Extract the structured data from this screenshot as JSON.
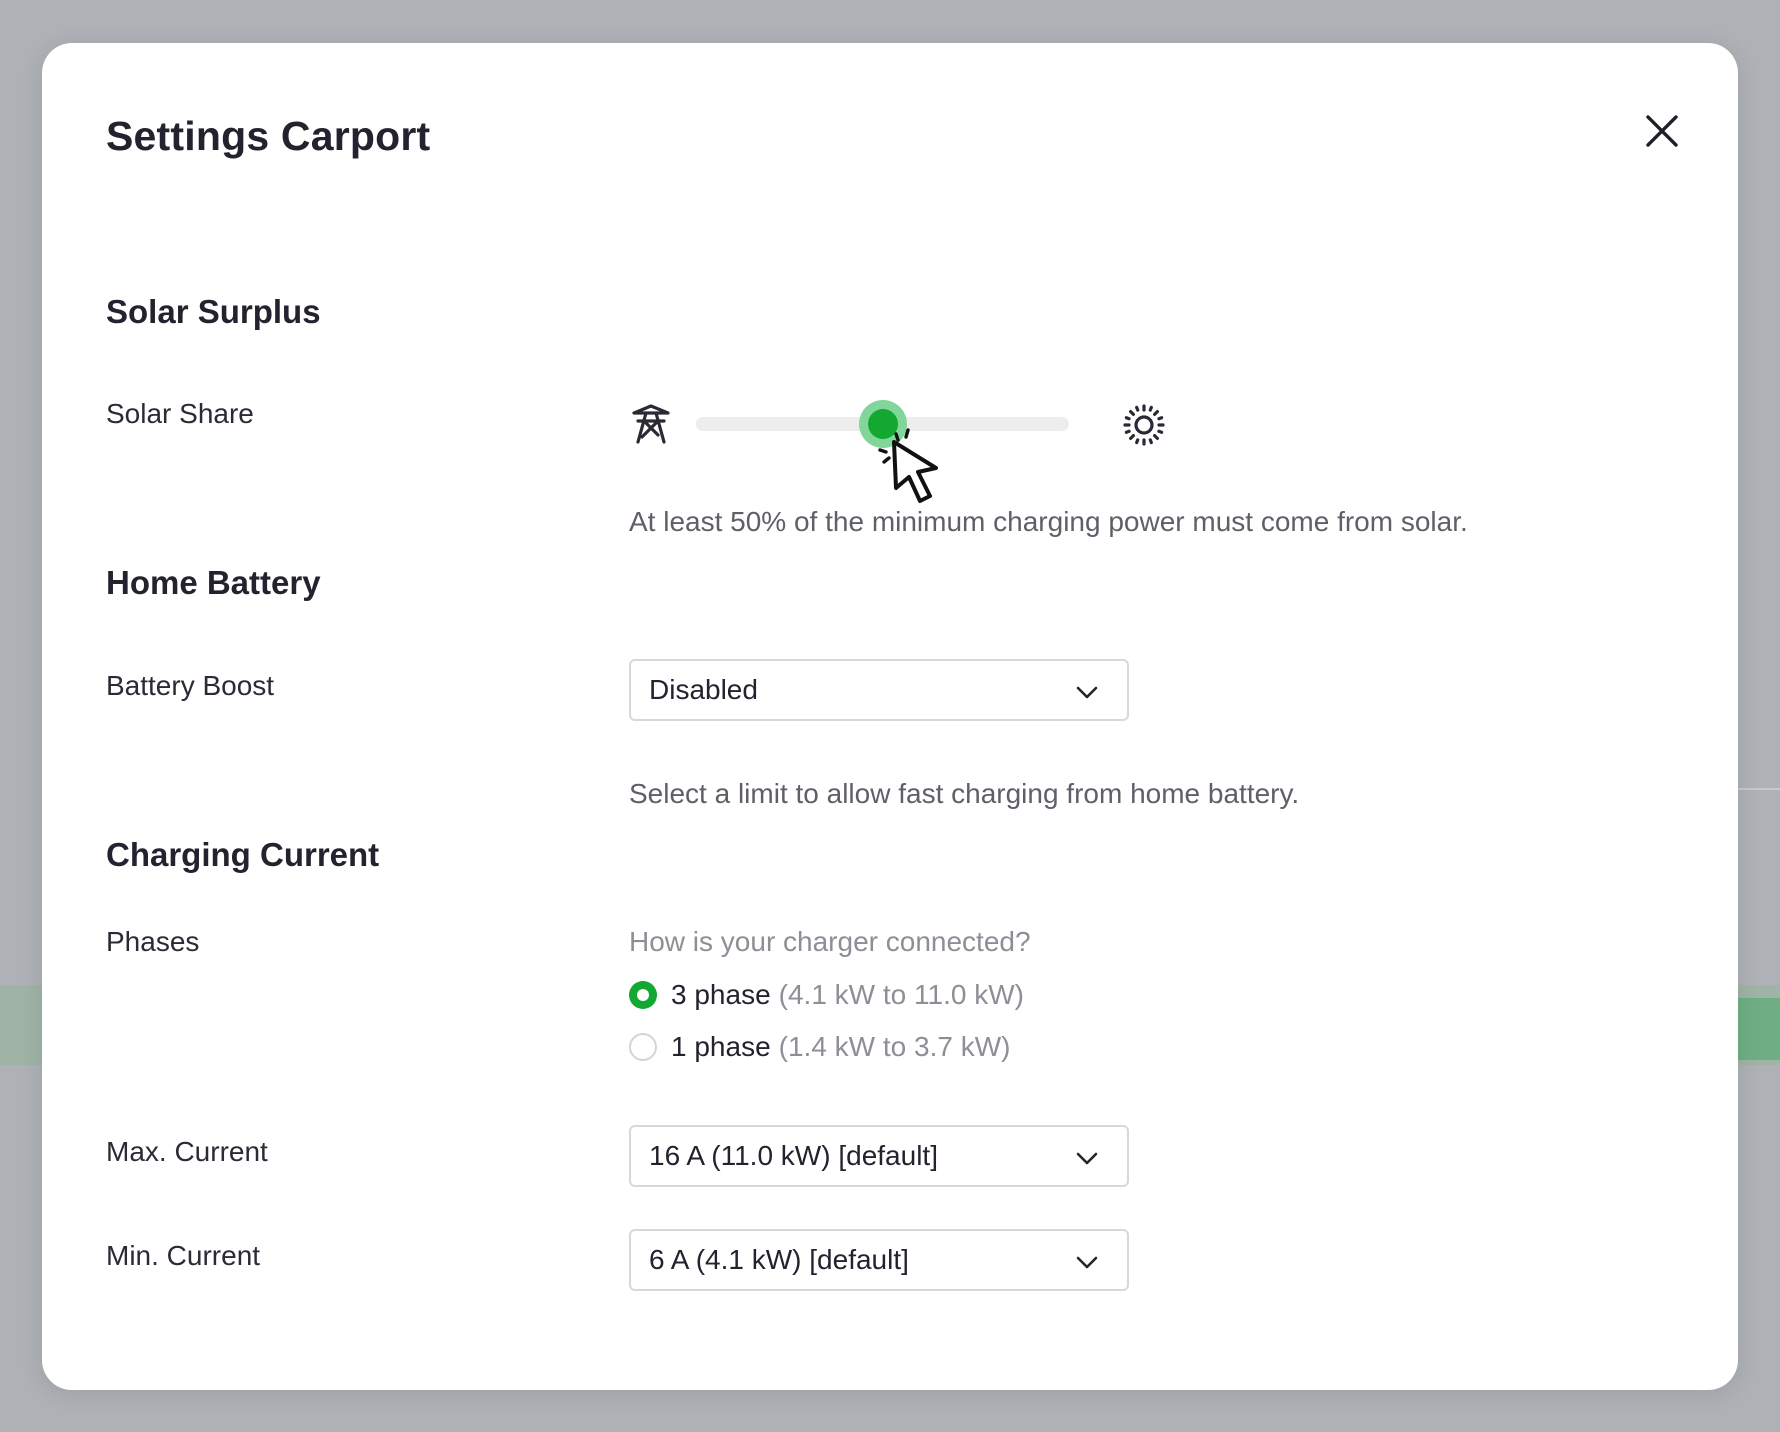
{
  "dialog": {
    "title": "Settings Carport",
    "close_icon": "close-icon"
  },
  "solar_surplus": {
    "heading": "Solar Surplus",
    "solar_share": {
      "label": "Solar Share",
      "value_percent": 50,
      "left_icon": "power-grid-icon",
      "right_icon": "sun-icon",
      "help": "At least 50% of the minimum charging power must come from solar."
    }
  },
  "home_battery": {
    "heading": "Home Battery",
    "battery_boost": {
      "label": "Battery Boost",
      "selected": "Disabled",
      "help": "Select a limit to allow fast charging from home battery."
    }
  },
  "charging_current": {
    "heading": "Charging Current",
    "phases": {
      "label": "Phases",
      "question": "How is your charger connected?",
      "options": [
        {
          "label": "3 phase",
          "detail": "(4.1 kW to 11.0 kW)",
          "checked": true
        },
        {
          "label": "1 phase",
          "detail": "(1.4 kW to 3.7 kW)",
          "checked": false
        }
      ]
    },
    "max_current": {
      "label": "Max. Current",
      "selected": "16 A (11.0 kW) [default]"
    },
    "min_current": {
      "label": "Min. Current",
      "selected": "6 A (4.1 kW) [default]"
    }
  },
  "colors": {
    "accent": "#12a832",
    "accent_light": "#82d69a",
    "text": "#23232f",
    "muted": "#8e8e96"
  }
}
